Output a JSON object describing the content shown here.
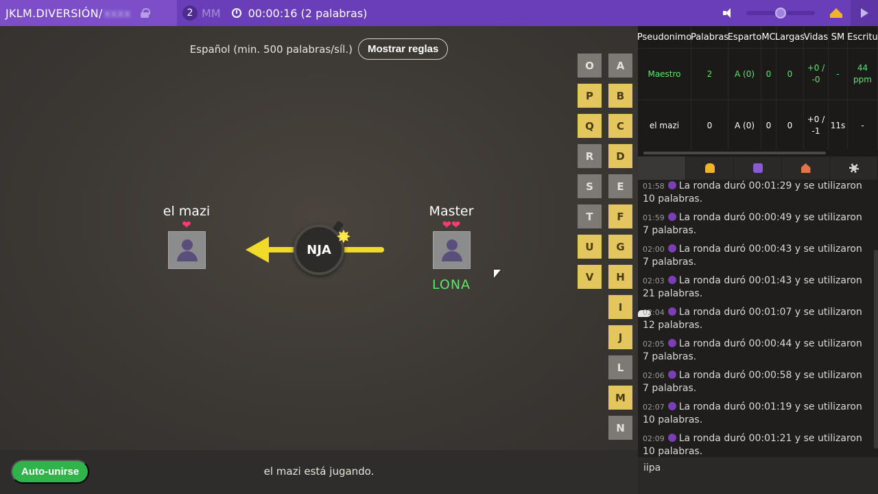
{
  "topbar": {
    "room_name": "JKLM.DIVERSIÓN/",
    "room_code": "xxxx",
    "player_count": "2",
    "mode": "MM",
    "timer": "00:00:16 (2 palabras)",
    "volume_level": 0.5
  },
  "game": {
    "rules_text": "Español (min. 500 palabras/síl.)",
    "rules_button": "Mostrar reglas",
    "players": [
      {
        "name": "el mazi",
        "hearts": "❤",
        "word": ""
      },
      {
        "name": "Master",
        "hearts": "❤❤",
        "word": "LONA"
      }
    ],
    "syllable": "NJA",
    "spark": "✸",
    "letters": [
      {
        "letter": "O",
        "used": false
      },
      {
        "letter": "P",
        "used": true
      },
      {
        "letter": "Q",
        "used": true
      },
      {
        "letter": "R",
        "used": false
      },
      {
        "letter": "S",
        "used": false
      },
      {
        "letter": "T",
        "used": false
      },
      {
        "letter": "U",
        "used": true
      },
      {
        "letter": "V",
        "used": true
      },
      {
        "letter": "A",
        "used": false
      },
      {
        "letter": "B",
        "used": true
      },
      {
        "letter": "C",
        "used": true
      },
      {
        "letter": "D",
        "used": true
      },
      {
        "letter": "E",
        "used": false
      },
      {
        "letter": "F",
        "used": true
      },
      {
        "letter": "G",
        "used": true
      },
      {
        "letter": "H",
        "used": true
      },
      {
        "letter": "I",
        "used": true
      },
      {
        "letter": "J",
        "used": true
      },
      {
        "letter": "L",
        "used": false
      },
      {
        "letter": "M",
        "used": true
      },
      {
        "letter": "N",
        "used": false
      }
    ],
    "autojoin_button": "Auto-unirse",
    "status_text": "el mazi está jugando."
  },
  "scoreboard": {
    "headers": [
      "Pseudonimo",
      "Palabras",
      "Esparto",
      "MC",
      "Largas",
      "Vidas",
      "SM",
      "Escritu"
    ],
    "rows": [
      [
        "Maestro",
        "2",
        "A (0)",
        "0",
        "0",
        "+0 / -0",
        "-",
        "44 ppm"
      ],
      [
        "el mazi",
        "0",
        "A (0)",
        "0",
        "0",
        "+0 / -1",
        "11s",
        "-"
      ]
    ]
  },
  "tabs": [
    "chat-icon",
    "people-icon",
    "joystick-icon",
    "home-icon",
    "gear-icon"
  ],
  "chat": [
    {
      "time": "01:58",
      "text": "La ronda duró 00:01:29 y se utilizaron 10 palabras."
    },
    {
      "time": "01:59",
      "text": "La ronda duró 00:00:49 y se utilizaron 7 palabras."
    },
    {
      "time": "02:00",
      "text": "La ronda duró 00:00:43 y se utilizaron 7 palabras."
    },
    {
      "time": "02:03",
      "text": "La ronda duró 00:01:43 y se utilizaron 21 palabras."
    },
    {
      "time": "02:04",
      "text": "La ronda duró 00:01:07 y se utilizaron 12 palabras."
    },
    {
      "time": "02:05",
      "text": "La ronda duró 00:00:44 y se utilizaron 7 palabras."
    },
    {
      "time": "02:06",
      "text": "La ronda duró 00:00:58 y se utilizaron 7 palabras."
    },
    {
      "time": "02:07",
      "text": "La ronda duró 00:01:19 y se utilizaron 10 palabras."
    },
    {
      "time": "02:09",
      "text": "La ronda duró 00:01:21 y se utilizaron 10 palabras."
    }
  ],
  "chat_input_value": "iipa",
  "colors": {
    "accent": "#7c4fc9",
    "tile_on": "#e3c65e",
    "tile_off": "#7d7a76",
    "word": "#5ee66b",
    "autojoin": "#2fb34a"
  }
}
